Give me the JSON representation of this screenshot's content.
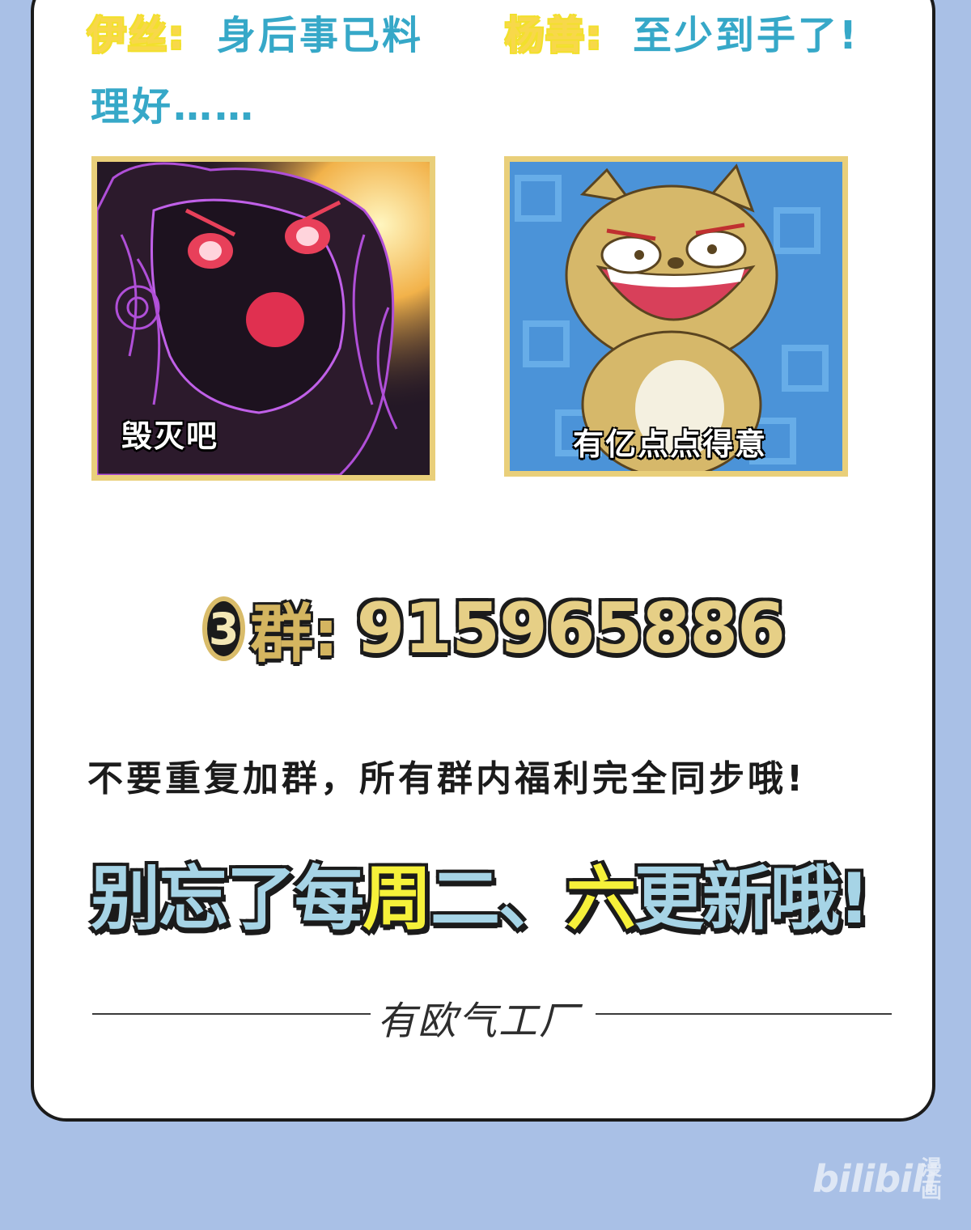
{
  "dialogue": {
    "speaker_left": "伊丝:",
    "line_left_1": "身后事已料",
    "line_left_2": "理好……",
    "speaker_right": "杨善:",
    "line_right": "至少到手了!"
  },
  "panels": {
    "left_caption": "毁灭吧",
    "right_caption": "有亿点点得意"
  },
  "group": {
    "circle_number": "3",
    "label": "群:",
    "number": "915965886"
  },
  "notice": "不要重复加群，所有群内福利完全同步哦!",
  "reminder": {
    "part1": "别忘了每",
    "part2": "周",
    "part3": "二、",
    "part4": "六",
    "part5": "更新哦!"
  },
  "signature": "有欧气工厂",
  "watermark": {
    "brand": "bilibili",
    "sub": "漫画"
  },
  "colors": {
    "background": "#a9c0e6",
    "dialogue_text": "#36a8c8",
    "speaker_tag": "#f2e02c",
    "group_gold": "#e6cf86",
    "reminder_blue": "#a6d4e6",
    "reminder_yellow": "#f6f13a"
  }
}
